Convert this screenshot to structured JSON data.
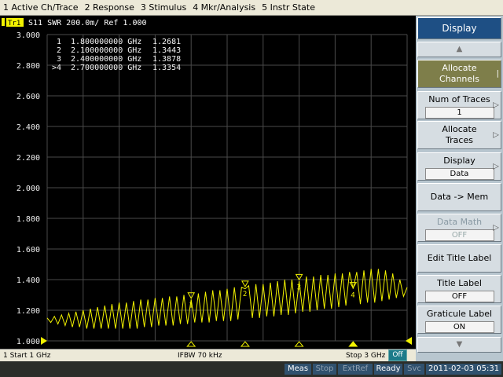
{
  "menu": [
    "1 Active Ch/Trace",
    "2 Response",
    "3 Stimulus",
    "4 Mkr/Analysis",
    "5 Instr State"
  ],
  "trace_header": {
    "badge": "Tr1",
    "text": "S11  SWR 200.0m/ Ref 1.000"
  },
  "markers": [
    {
      "label": "1",
      "freq": "1.800000000 GHz",
      "value": "1.2681",
      "x_ghz": 1.8,
      "y": 1.2681
    },
    {
      "label": "2",
      "freq": "2.100000000 GHz",
      "value": "1.3443",
      "x_ghz": 2.1,
      "y": 1.3443
    },
    {
      "label": "3",
      "freq": "2.400000000 GHz",
      "value": "1.3878",
      "x_ghz": 2.4,
      "y": 1.3878
    },
    {
      "label": ">4",
      "freq": "2.700000000 GHz",
      "value": "1.3354",
      "x_ghz": 2.7,
      "y": 1.3354
    }
  ],
  "chart_data": {
    "type": "line",
    "title": "S11  SWR 200.0m/ Ref 1.000",
    "xlabel": "",
    "ylabel": "",
    "xlim": [
      1,
      3
    ],
    "ylim": [
      1.0,
      3.0
    ],
    "ytick_labels": [
      "3.000",
      "2.800",
      "2.600",
      "2.400",
      "2.200",
      "2.000",
      "1.800",
      "1.600",
      "1.400",
      "1.200",
      "1.000"
    ],
    "grid": true,
    "series": [
      {
        "x": [
          1.0,
          1.02,
          1.04,
          1.06,
          1.08,
          1.1,
          1.12,
          1.14,
          1.16,
          1.18,
          1.2,
          1.22,
          1.24,
          1.26,
          1.28,
          1.3,
          1.32,
          1.34,
          1.36,
          1.38,
          1.4,
          1.42,
          1.44,
          1.46,
          1.48,
          1.5,
          1.52,
          1.54,
          1.56,
          1.58,
          1.6,
          1.62,
          1.64,
          1.66,
          1.68,
          1.7,
          1.72,
          1.74,
          1.76,
          1.78,
          1.8,
          1.82,
          1.84,
          1.86,
          1.88,
          1.9,
          1.92,
          1.94,
          1.96,
          1.98,
          2.0,
          2.02,
          2.04,
          2.06,
          2.08,
          2.1,
          2.12,
          2.14,
          2.16,
          2.18,
          2.2,
          2.22,
          2.24,
          2.26,
          2.28,
          2.3,
          2.32,
          2.34,
          2.36,
          2.38,
          2.4,
          2.42,
          2.44,
          2.46,
          2.48,
          2.5,
          2.52,
          2.54,
          2.56,
          2.58,
          2.6,
          2.62,
          2.64,
          2.66,
          2.68,
          2.7,
          2.72,
          2.74,
          2.76,
          2.78,
          2.8,
          2.82,
          2.84,
          2.86,
          2.88,
          2.9,
          2.92,
          2.94,
          2.96,
          2.98,
          3.0
        ],
        "values": [
          1.15,
          1.12,
          1.16,
          1.11,
          1.17,
          1.1,
          1.18,
          1.09,
          1.19,
          1.09,
          1.2,
          1.08,
          1.21,
          1.08,
          1.22,
          1.08,
          1.23,
          1.08,
          1.24,
          1.08,
          1.25,
          1.08,
          1.25,
          1.08,
          1.26,
          1.08,
          1.27,
          1.09,
          1.27,
          1.09,
          1.28,
          1.1,
          1.28,
          1.1,
          1.29,
          1.1,
          1.29,
          1.11,
          1.3,
          1.11,
          1.27,
          1.12,
          1.31,
          1.12,
          1.32,
          1.12,
          1.33,
          1.13,
          1.33,
          1.13,
          1.34,
          1.13,
          1.35,
          1.14,
          1.35,
          1.34,
          1.36,
          1.15,
          1.37,
          1.15,
          1.37,
          1.16,
          1.38,
          1.16,
          1.39,
          1.17,
          1.4,
          1.17,
          1.4,
          1.18,
          1.39,
          1.19,
          1.42,
          1.19,
          1.42,
          1.2,
          1.43,
          1.21,
          1.43,
          1.21,
          1.44,
          1.22,
          1.44,
          1.23,
          1.45,
          1.34,
          1.45,
          1.24,
          1.46,
          1.25,
          1.47,
          1.25,
          1.47,
          1.26,
          1.46,
          1.27,
          1.44,
          1.28,
          1.4,
          1.29,
          1.35
        ]
      }
    ]
  },
  "footer": {
    "start": "1  Start 1 GHz",
    "ifbw": "IFBW 70 kHz",
    "stop": "Stop 3 GHz",
    "off": "Off"
  },
  "status": {
    "meas": "Meas",
    "stop": "Stop",
    "extref": "ExtRef",
    "ready": "Ready",
    "svc": "Svc",
    "datetime": "2011-02-03 05:31"
  },
  "softkeys": {
    "title": "Display",
    "up_arrow": "▲",
    "allocate_channels": "Allocate Channels",
    "num_traces_label": "Num of Traces",
    "num_traces_value": "1",
    "allocate_traces": "Allocate Traces",
    "display_label": "Display",
    "display_value": "Data",
    "data_to_mem": "Data -> Mem",
    "data_math_label": "Data Math",
    "data_math_value": "OFF",
    "edit_title_label": "Edit Title Label",
    "title_label_label": "Title Label",
    "title_label_value": "OFF",
    "graticule_label": "Graticule Label",
    "graticule_value": "ON",
    "down_arrow": "▼"
  },
  "colors": {
    "trace": "#f2f200",
    "grid": "#4a4a4a",
    "ytick": "#f0f0f0",
    "accent_blue": "#1e4f84",
    "allocate_bg": "#7e7e4a"
  }
}
